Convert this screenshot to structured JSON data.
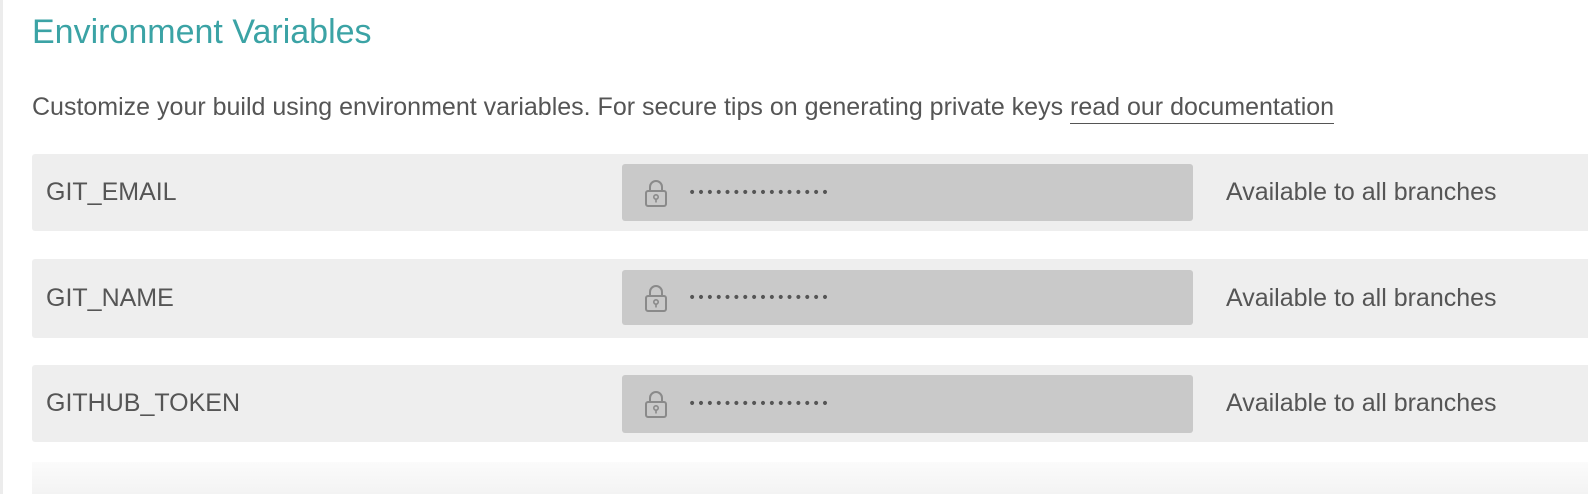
{
  "section": {
    "title": "Environment Variables",
    "description": "Customize your build using environment variables. For secure tips on generating private keys ",
    "doc_link_label": "read our documentation"
  },
  "env_vars": [
    {
      "name": "GIT_EMAIL",
      "masked_value": "••••••••••••••••",
      "scope": "Available to all branches"
    },
    {
      "name": "GIT_NAME",
      "masked_value": "••••••••••••••••",
      "scope": "Available to all branches"
    },
    {
      "name": "GITHUB_TOKEN",
      "masked_value": "••••••••••••••••",
      "scope": "Available to all branches"
    }
  ],
  "icons": {
    "secret_field": "lock-icon"
  },
  "colors": {
    "accent": "#3ba3a5",
    "text": "#555555",
    "row_background": "#eeeeee",
    "field_background": "#c9c9c9",
    "icon_stroke": "#8a8a8a"
  }
}
